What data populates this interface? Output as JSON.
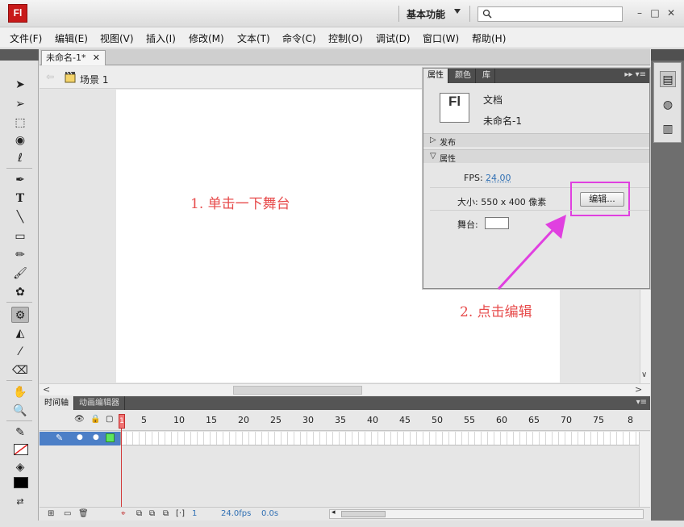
{
  "app": {
    "logo": "Fl"
  },
  "titlebar": {
    "workspace": "基本功能",
    "search_placeholder": ""
  },
  "menu": [
    "文件(F)",
    "编辑(E)",
    "视图(V)",
    "插入(I)",
    "修改(M)",
    "文本(T)",
    "命令(C)",
    "控制(O)",
    "调试(D)",
    "窗口(W)",
    "帮助(H)"
  ],
  "document": {
    "tab_title": "未命名-1*",
    "scene_label": "场景 1"
  },
  "annotations": {
    "step1": "1. 单击一下舞台",
    "step2": "2. 点击编辑"
  },
  "properties": {
    "tabs": [
      "属性",
      "颜色",
      "库"
    ],
    "doc_icon_label": "Fl",
    "doc_type": "文档",
    "doc_name": "未命名-1",
    "section_publish": "发布",
    "section_properties": "属性",
    "fps_label": "FPS:",
    "fps_value": "24.00",
    "size_label": "大小: 550 x 400 像素",
    "edit_button": "编辑...",
    "stage_label": "舞台:",
    "stage_color": "#ffffff"
  },
  "timeline": {
    "tabs": [
      "时间轴",
      "动画编辑器"
    ],
    "frame_numbers": [
      "1",
      "5",
      "10",
      "15",
      "20",
      "25",
      "30",
      "35",
      "40",
      "45",
      "50",
      "55",
      "60",
      "65",
      "70",
      "75",
      "8"
    ],
    "current_frame": "1",
    "fps": "24.0",
    "fps_unit": "fps",
    "elapsed": "0.0",
    "elapsed_unit": "s",
    "layer_color": "#5ee65e"
  },
  "colors": {
    "accent": "#e040e0",
    "annotation": "#e74c4c",
    "layer_highlight": "#4c7fc7"
  }
}
